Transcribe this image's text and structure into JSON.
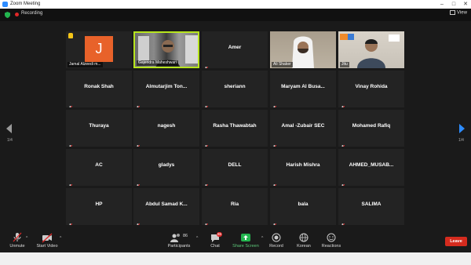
{
  "window": {
    "title": "Zoom Meeting"
  },
  "topbar": {
    "recording_label": "Recording",
    "view_label": "View"
  },
  "grid": {
    "page_left": "1/4",
    "page_right": "1/4",
    "rows": [
      [
        {
          "name": "Jamal Alzeedi m...",
          "type": "avatar",
          "initial": "J"
        },
        {
          "name": "Gajendra Maheshwari",
          "type": "video"
        },
        {
          "name": "Amer",
          "type": "name"
        },
        {
          "name": "Ali Shaker",
          "type": "video"
        },
        {
          "name": "Jitu",
          "type": "video"
        }
      ],
      [
        {
          "name": "Ronak Shah",
          "type": "name"
        },
        {
          "name": "Almutarjim Ton...",
          "type": "name"
        },
        {
          "name": "sheriann",
          "type": "name"
        },
        {
          "name": "Maryam Al Busa...",
          "type": "name"
        },
        {
          "name": "Vinay Rohida",
          "type": "name"
        }
      ],
      [
        {
          "name": "Thuraya",
          "type": "name"
        },
        {
          "name": "nagesh",
          "type": "name"
        },
        {
          "name": "Rasha Thawabtah",
          "type": "name"
        },
        {
          "name": "Amal -Zubair SEC",
          "type": "name"
        },
        {
          "name": "Mohamed Rafiq",
          "type": "name"
        }
      ],
      [
        {
          "name": "AC",
          "type": "name"
        },
        {
          "name": "gladys",
          "type": "name"
        },
        {
          "name": "DELL",
          "type": "name"
        },
        {
          "name": "Harish Mishra",
          "type": "name"
        },
        {
          "name": "AHMED_MUSAB...",
          "type": "name"
        }
      ],
      [
        {
          "name": "HP",
          "type": "name"
        },
        {
          "name": "Abdul Samad K...",
          "type": "name"
        },
        {
          "name": "Ria",
          "type": "name"
        },
        {
          "name": "bala",
          "type": "name"
        },
        {
          "name": "SALIMA",
          "type": "name"
        }
      ]
    ]
  },
  "toolbar": {
    "unmute": "Unmute",
    "start_video": "Start Video",
    "participants": "Participants",
    "participants_count": "86",
    "chat": "Chat",
    "chat_badge": "86",
    "share_screen": "Share Screen",
    "record": "Record",
    "korean": "Korean",
    "reactions": "Reactions",
    "leave": "Leave"
  },
  "colors": {
    "active_speaker": "#b7e51e",
    "accent": "#2d8cff",
    "leave": "#d52b1e",
    "share": "#23b54f"
  }
}
